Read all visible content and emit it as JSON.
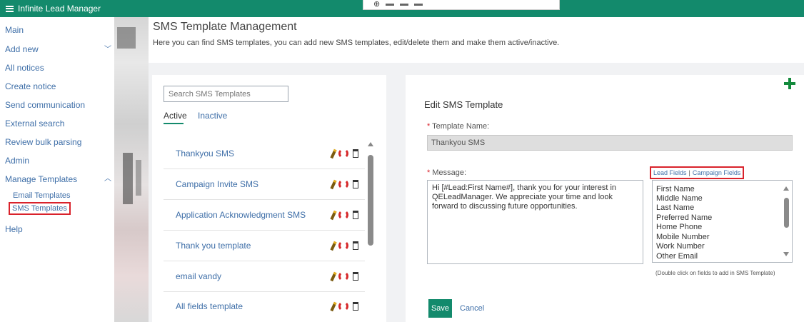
{
  "app": {
    "title": "Infinite Lead Manager"
  },
  "sidebar": {
    "items": [
      {
        "label": "Main"
      },
      {
        "label": "Add new",
        "chevron": "chevron-down"
      },
      {
        "label": "All notices"
      },
      {
        "label": "Create notice"
      },
      {
        "label": "Send communication"
      },
      {
        "label": "External search"
      },
      {
        "label": "Review bulk parsing"
      },
      {
        "label": "Admin"
      },
      {
        "label": "Manage Templates",
        "chevron": "chevron-up",
        "expanded": true
      }
    ],
    "subitems": [
      {
        "label": "Email Templates"
      },
      {
        "label": "SMS Templates",
        "selected": true
      }
    ],
    "help": "Help"
  },
  "page": {
    "title": "SMS Template Management",
    "description": "Here you can find SMS templates, you can add new SMS templates, edit/delete them and make them active/inactive."
  },
  "list": {
    "search_placeholder": "Search SMS Templates",
    "tabs": {
      "active": "Active",
      "inactive": "Inactive"
    },
    "rows": [
      {
        "name": "Thankyou SMS"
      },
      {
        "name": "Campaign Invite SMS"
      },
      {
        "name": "Application Acknowledgment SMS"
      },
      {
        "name": "Thank you template"
      },
      {
        "name": "email vandy"
      },
      {
        "name": "All fields template"
      }
    ]
  },
  "edit": {
    "title": "Edit SMS Template",
    "name_label": "Template Name:",
    "name_value": "Thankyou SMS",
    "message_label": "Message:",
    "message_value": "Hi [#Lead:First Name#], thank you for your interest in QELeadManager. We appreciate your time and look forward to discussing future opportunities.",
    "lead_fields_link": "Lead Fields",
    "separator": "|",
    "campaign_fields_link": "Campaign Fields",
    "fields": [
      "First Name",
      "Middle Name",
      "Last Name",
      "Preferred Name",
      "Home Phone",
      "Mobile Number",
      "Work Number",
      "Other Email"
    ],
    "hint": "(Double click on fields to add in SMS Template)",
    "save": "Save",
    "cancel": "Cancel"
  },
  "colors": {
    "brand": "#138a6c",
    "link": "#3f6fa8",
    "highlight": "#d9222b",
    "add_icon": "#138a3c"
  },
  "icons": [
    "menu-icon",
    "chevron-down-icon",
    "chevron-up-icon",
    "add-icon",
    "edit-icon",
    "toggle-status-icon",
    "delete-icon"
  ]
}
